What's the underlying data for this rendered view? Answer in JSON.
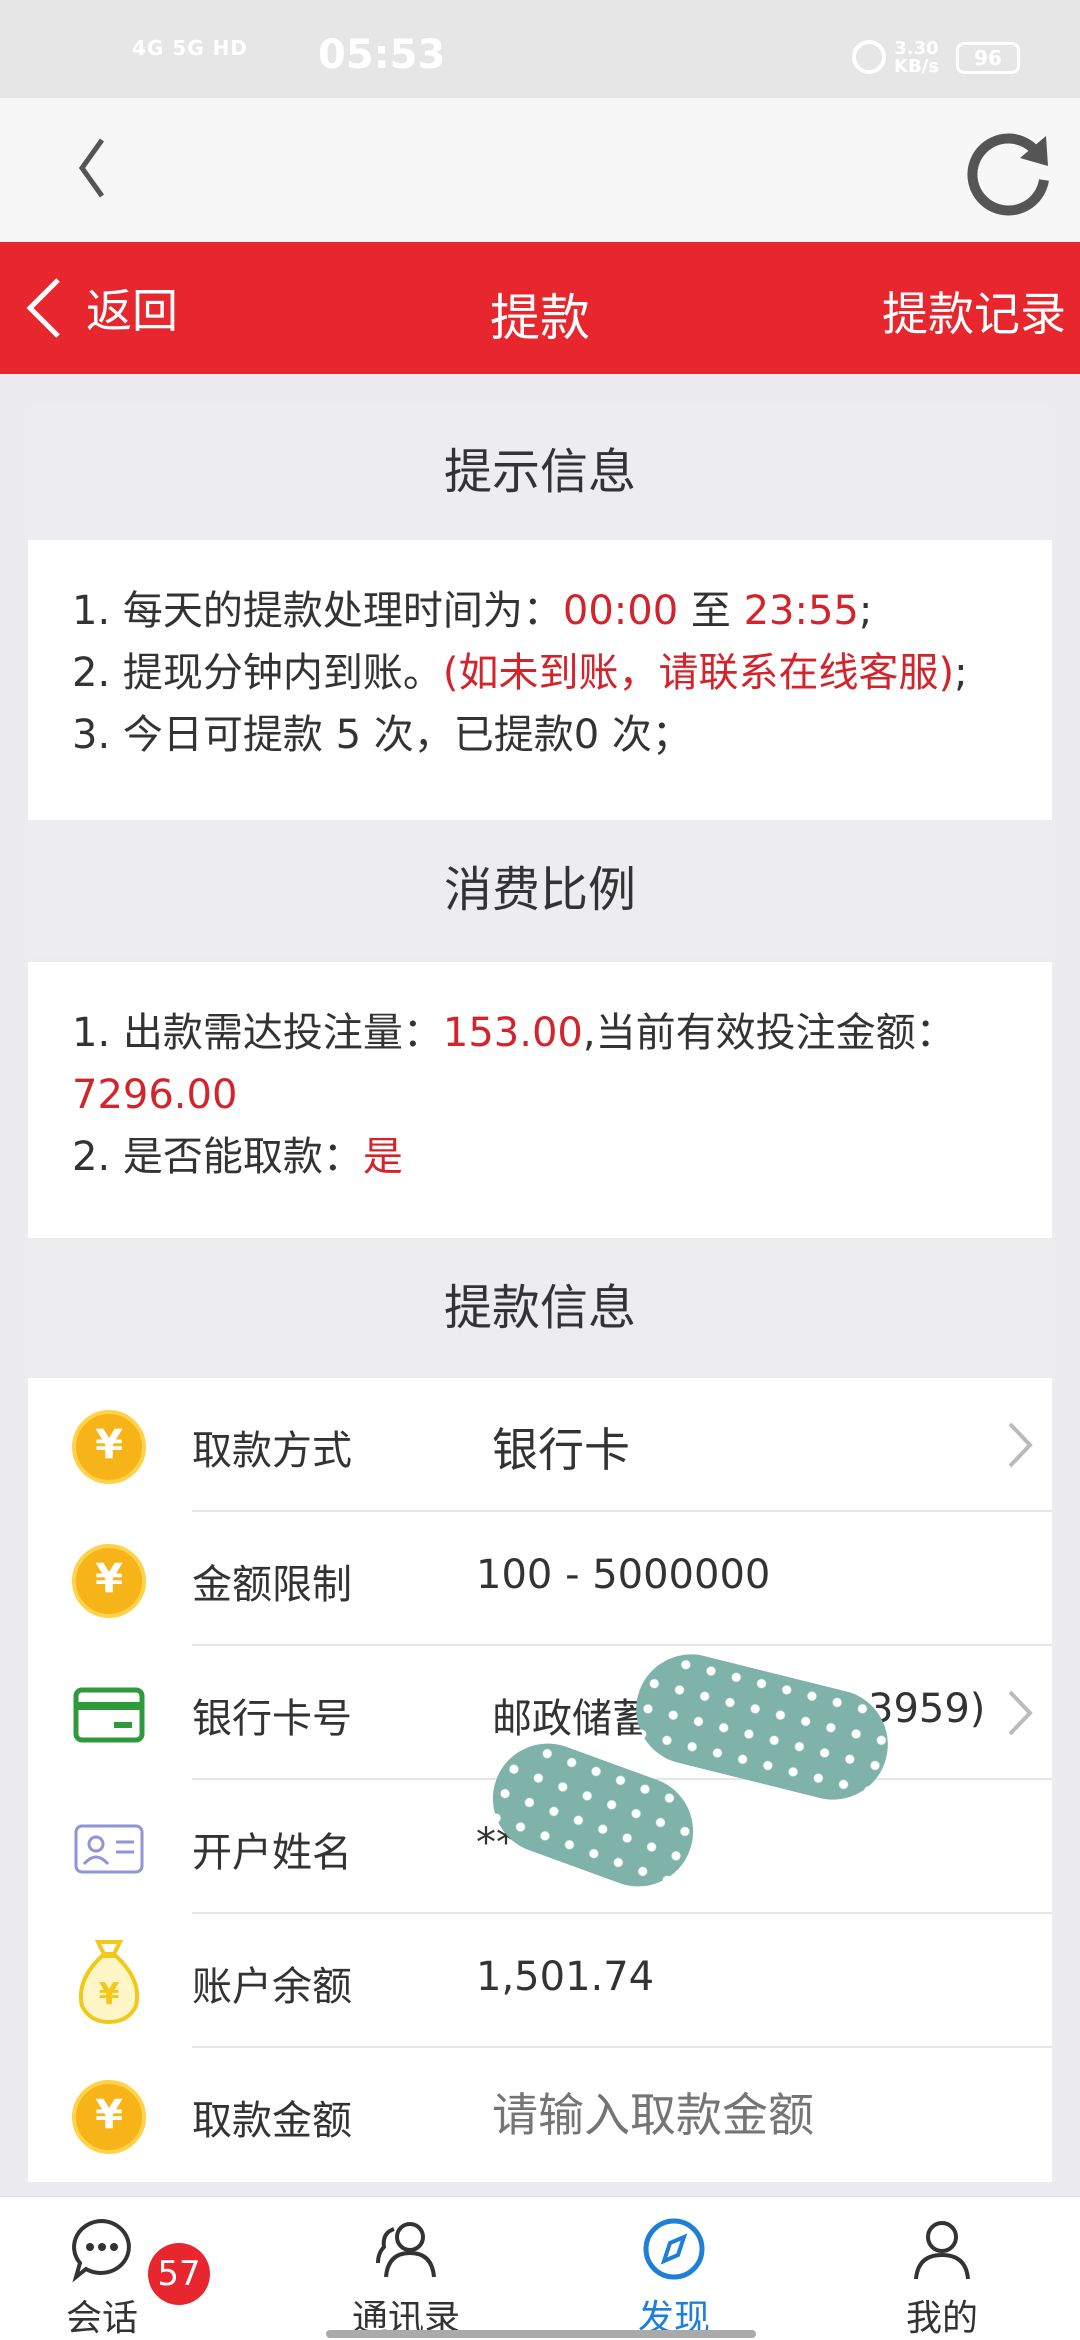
{
  "status_bar": {
    "network": "4G 5G HD",
    "time": "05:53",
    "speed": "3.30\nKB/s",
    "battery": "96"
  },
  "header": {
    "back_label": "返回",
    "title": "提款",
    "records_label": "提款记录"
  },
  "notice": {
    "title": "提示信息",
    "line1_prefix": "1. 每天的提款处理时间为：",
    "line1_start": "00:00",
    "line1_mid": " 至 ",
    "line1_end": "23:55",
    "line1_suffix": ";",
    "line2_prefix": "2. 提现分钟内到账。",
    "line2_red": "(如未到账，请联系在线客服)",
    "line2_suffix": ";",
    "line3": "3. 今日可提款 5 次，已提款0 次；"
  },
  "consumption": {
    "title": "消费比例",
    "line1_prefix": "1. 出款需达投注量：",
    "line1_value": "153.00",
    "line1_suffix": ",当前有效投注金额：",
    "line1_current": "7296.00",
    "line2_prefix": "2. 是否能取款：",
    "line2_value": "是"
  },
  "withdraw_info": {
    "title": "提款信息",
    "method_label": "取款方式",
    "method_value": "银行卡",
    "limit_label": "金额限制",
    "limit_value": "100 - 5000000",
    "card_label": "银行卡号",
    "card_value": "邮政储蓄",
    "card_suffix": "3959)",
    "name_label": "开户姓名",
    "name_value": "**",
    "balance_label": "账户余额",
    "balance_value": "1,501.74",
    "amount_label": "取款金额",
    "amount_placeholder": "请输入取款金额"
  },
  "tabbar": {
    "chat": "会话",
    "chat_badge": "57",
    "contacts": "通讯录",
    "discover": "发现",
    "me": "我的"
  },
  "colors": {
    "brand_red": "#e8262d",
    "accent_blue": "#1e7fd6",
    "coin_yellow": "#f7b418"
  }
}
